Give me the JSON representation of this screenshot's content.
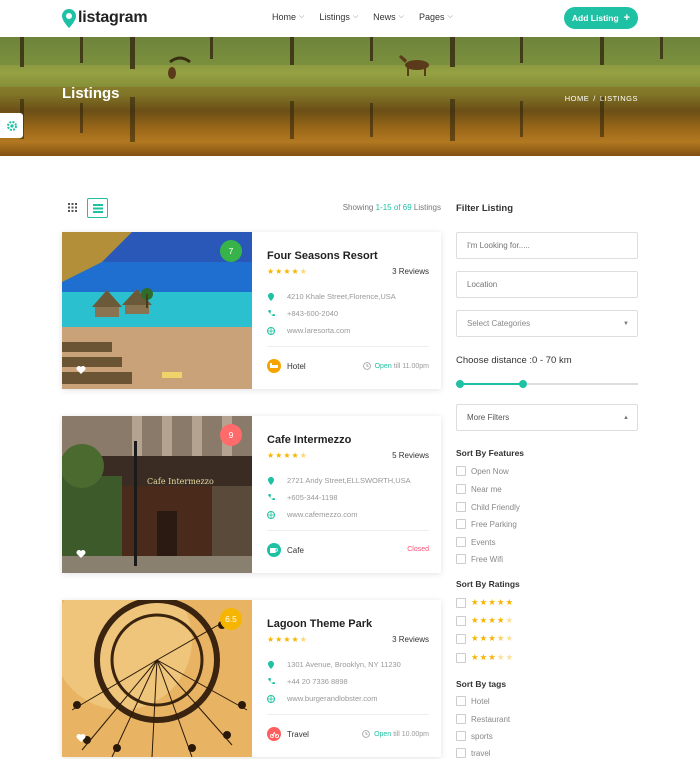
{
  "brand": {
    "name": "listagram",
    "accent": "#1ec1a3"
  },
  "nav": {
    "items": [
      {
        "label": "Home"
      },
      {
        "label": "Listings"
      },
      {
        "label": "News"
      },
      {
        "label": "Pages"
      }
    ],
    "add_listing": "Add Listing"
  },
  "hero": {
    "title": "Listings",
    "breadcrumb": [
      "HOME",
      "LISTINGS"
    ]
  },
  "toolbar": {
    "showing_prefix": "Showing ",
    "showing_range": "1-15 of 69",
    "showing_suffix": " Listings",
    "view_mode": "list"
  },
  "listings": [
    {
      "rating": "7",
      "rating_color": "#38b34a",
      "title": "Four Seasons Resort",
      "stars": 3.5,
      "reviews": "3 Reviews",
      "address": "4210 Khale Street,Florence,USA",
      "phone": "+843-600-2040",
      "website": "www.laresorta.com",
      "category": "Hotel",
      "category_color": "#f6a300",
      "category_icon": "bed-icon",
      "status_label": "Open",
      "status_time": "till 11.00pm",
      "is_open": true
    },
    {
      "rating": "9",
      "rating_color": "#ff6b6b",
      "title": "Cafe Intermezzo",
      "stars": 3.5,
      "reviews": "5 Reviews",
      "address": "2721 Andy Street,ELLSWORTH,USA",
      "phone": "+605-344-1198",
      "website": "www.cafemezzo.com",
      "category": "Cafe",
      "category_color": "#1ec1a3",
      "category_icon": "coffee-icon",
      "status_label": "Closed",
      "status_time": "",
      "is_open": false
    },
    {
      "rating": "6.5",
      "rating_color": "#f6b500",
      "title": "Lagoon Theme Park",
      "stars": 3.5,
      "reviews": "3 Reviews",
      "address": "1301 Avenue, Brooklyn, NY 11230",
      "phone": "+44 20 7336 8898",
      "website": "www.burgerandlobster.com",
      "category": "Travel",
      "category_color": "#ff5e5e",
      "category_icon": "bike-icon",
      "status_label": "Open",
      "status_time": "till 10.00pm",
      "is_open": true
    }
  ],
  "sidebar": {
    "title": "Filter Listing",
    "search_placeholder": "I'm Looking for.....",
    "location_placeholder": "Location",
    "category_select": "Select Categories",
    "distance_label": "Choose distance :0 - 70 km",
    "distance_min": 0,
    "distance_max": 70,
    "distance_fill_fraction": 0.36,
    "more_filters": "More Filters",
    "features_title": "Sort By Features",
    "features": [
      "Open Now",
      "Near me",
      "Child Friendly",
      "Free Parking",
      "Events",
      "Free Wifi"
    ],
    "ratings_title": "Sort By Ratings",
    "ratings": [
      5,
      4,
      3.5,
      3
    ],
    "tags_title": "Sort By tags",
    "tags": [
      "Hotel",
      "Restaurant",
      "sports",
      "travel"
    ]
  }
}
